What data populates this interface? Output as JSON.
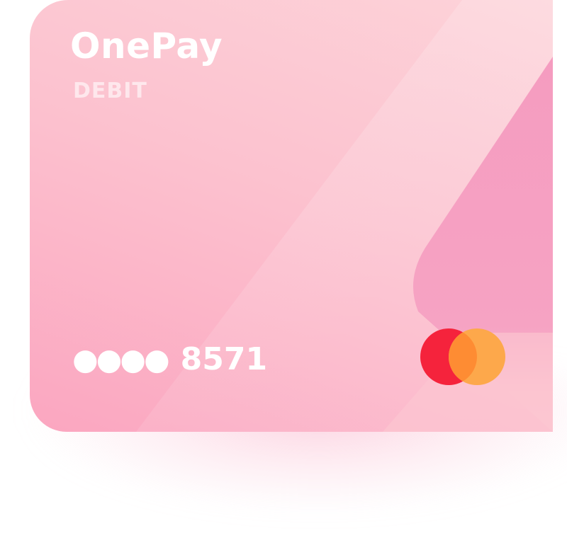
{
  "card": {
    "brand": "OnePay",
    "type": "DEBIT",
    "masked_dots": "●●●●",
    "last_four": "8571",
    "network_icon": "two-circles-card-network-icon"
  },
  "colors": {
    "card_light": "#fdd3d9",
    "card_dark": "#fba6c0",
    "accent_shape": "#f6a3c3",
    "network_red": "#f5233c",
    "network_orange": "#fda84b",
    "network_overlap": "#fe8c33"
  }
}
